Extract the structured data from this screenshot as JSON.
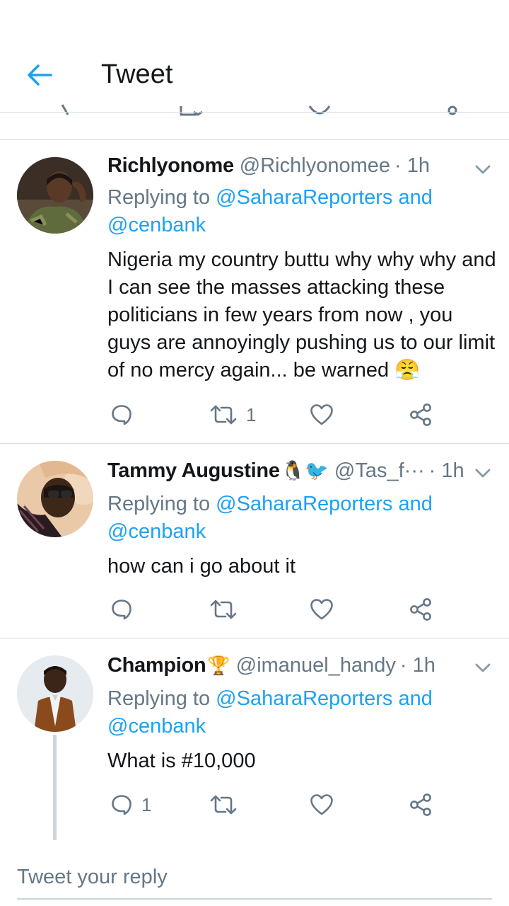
{
  "header": {
    "title": "Tweet"
  },
  "compose": {
    "placeholder": "Tweet your reply"
  },
  "colors": {
    "accent": "#1da1f2",
    "text": "#14171a",
    "muted": "#657786",
    "border": "#d8dde1"
  },
  "tweets": [
    {
      "name": "Richlyonome",
      "emojis": "",
      "handle": "@Richlyonomee",
      "time": "· 1h",
      "replying_prefix": "Replying to ",
      "replying_to": "@SaharaReporters and @cenbank",
      "text": "Nigeria my country buttu why why why and I can see the masses attacking these politicians in few years from now , you guys are annoyingly pushing us to our limit of no mercy again... be warned 😤",
      "reply_count": "",
      "retweet_count": "1",
      "like_count": ""
    },
    {
      "name": "Tammy Augustine",
      "emojis": "🐧🐦",
      "handle": "@Tas_f···",
      "time": "· 1h",
      "replying_prefix": "Replying to ",
      "replying_to": "@SaharaReporters and @cenbank",
      "text": "how can i go about it",
      "reply_count": "",
      "retweet_count": "",
      "like_count": ""
    },
    {
      "name": "Champion",
      "emojis": "🏆",
      "handle": "@imanuel_handy",
      "time": "· 1h",
      "replying_prefix": "Replying to ",
      "replying_to": "@SaharaReporters and @cenbank",
      "text": "What is #10,000",
      "reply_count": "1",
      "retweet_count": "",
      "like_count": ""
    }
  ]
}
